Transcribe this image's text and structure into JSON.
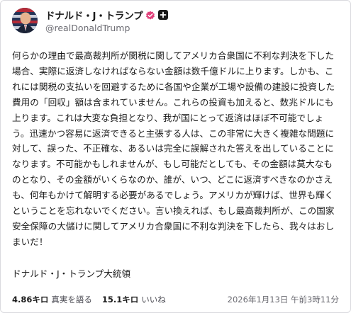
{
  "post": {
    "display_name": "ドナルド・J・トランプ",
    "handle": "@realDonaldTrump",
    "verified_color": "#e0407a",
    "body": "何らかの理由で最高裁判所が関税に関してアメリカ合衆国に不利な判決を下した場合、実際に返済しなければならない金額は数千億ドルに上ります。しかも、これには関税の支払いを回避するために各国や企業が工場や設備の建設に投資した費用の「回収」額は含まれていません。これらの投資も加えると、数兆ドルにも上ります。これは大変な負担となり、我が国にとって返済はほぼ不可能でしょう。迅速かつ容易に返済できると主張する人は、この非常に大きく複雑な問題に対して、誤った、不正確な、あるいは完全に誤解された答えを出していることになります。不可能かもしれませんが、もし可能だとしても、その金額は莫大なものとなり、その金額がいくらなのか、誰が、いつ、どこに返済すべきなのかさえも、何年もかけて解明する必要があるでしょう。アメリカが輝けば、世界も輝くということを忘れないでください。言い換えれば、もし最高裁判所が、この国家安全保障の大儲けに関してアメリカ合衆国に不利な判決を下したら、我々はおしまいだ！",
    "signature": "ドナルド・J・トランプ大統領"
  },
  "footer": {
    "retruths_count": "4.86キロ",
    "retruths_label": "真実を語る",
    "likes_count": "15.1キロ",
    "likes_label": "いいね",
    "timestamp": "2026年1月13日 午前3時11分"
  },
  "icons": {
    "avatar": "profile-photo-icon",
    "verified": "verified-badge-icon",
    "follow": "follow-plus-icon"
  }
}
